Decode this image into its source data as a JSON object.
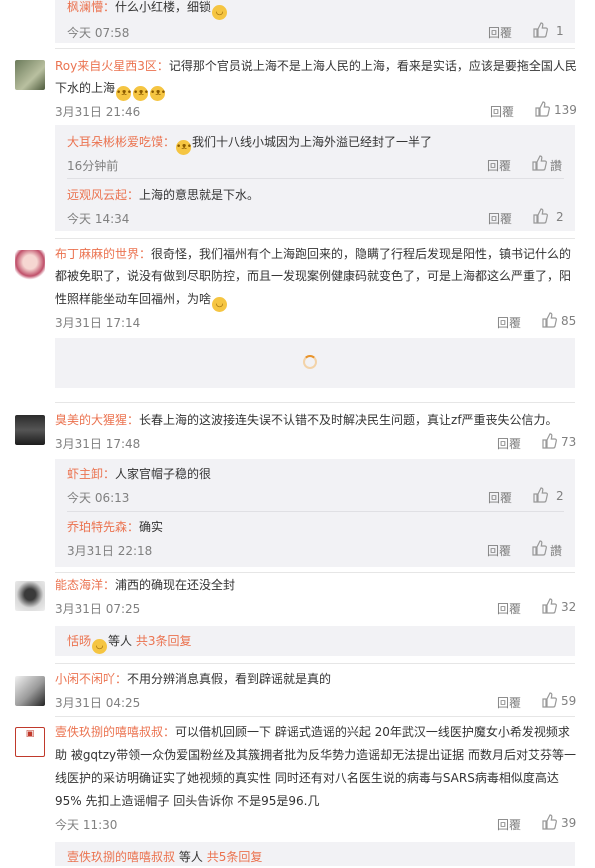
{
  "actions": {
    "reply": "回覆"
  },
  "comments": [
    {
      "user": "枫澜懵：",
      "text": "什么小红楼，细锁",
      "time": "今天 07:58",
      "likes": "1"
    },
    {
      "user": "Roy来自火星西3区：",
      "text1": "记得那个官员说上海不是上海人民的上海，看来是实话，应该是要拖全国人民",
      "text2": "下水的上海",
      "time": "3月31日 21:46",
      "likes": "139",
      "replies": [
        {
          "user": "大耳朵彬彬爱吃馍：",
          "text": "我们十八线小城因为上海外溢已经封了一半了",
          "time": "16分钟前",
          "likes": "讚"
        },
        {
          "user": "远观风云起：",
          "text": "上海的意思就是下水。",
          "time": "今天 14:34",
          "likes": "2"
        }
      ]
    },
    {
      "user": "布丁麻麻的世界：",
      "text1": "很奇怪，我们福州有个上海跑回来的，隐瞒了行程后发现是阳性，镇书记什么的",
      "text2": "都被免职了，说没有做到尽职防控，而且一发现案例健康码就变色了，可是上海都这么严重了，阳",
      "text3": "性照样能坐动车回福州，为啥",
      "time": "3月31日 17:14",
      "likes": "85"
    },
    {
      "user": "臭美的大猩猩：",
      "text": "长春上海的这波接连失误不认错不及时解决民生问题，真让zf严重丧失公信力。",
      "time": "3月31日 17:48",
      "likes": "73",
      "replies": [
        {
          "user": "虾主卸：",
          "text": "人家官帽子稳的很",
          "time": "今天 06:13",
          "likes": "2"
        },
        {
          "user": "乔珀特先森：",
          "text": "确实",
          "time": "3月31日 22:18",
          "likes": "讚"
        }
      ]
    },
    {
      "user": "能态海洋：",
      "text": "浦西的确现在还没全封",
      "time": "3月31日 07:25",
      "likes": "32",
      "more": {
        "user": "恬旸",
        "mid": "等人",
        "count": "共3条回复"
      }
    },
    {
      "user": "小闲不闲吖：",
      "text": "不用分辨消息真假，看到辟谣就是真的",
      "time": "3月31日 04:25",
      "likes": "59"
    },
    {
      "user": "壹佚玖捌的嘻嘻叔叔：",
      "text1": "可以借机回顾一下 辟谣式造谣的兴起 20年武汉一线医护魔女小希发视频求",
      "text2": "助 被gqtzy带领一众伪爱国粉丝及其簇拥者批为反华势力造谣却无法提出证据 而数月后对艾芬等一",
      "text3": "线医护的采访明确证实了她视频的真实性 同时还有对八名医生说的病毒与SARS病毒相似度高达",
      "text4": "95% 先扣上造谣帽子 回头告诉你 不是95是96.几",
      "time": "今天 11:30",
      "likes": "39",
      "more": {
        "user": "壹佚玖捌的嘻嘻叔叔",
        "mid": "等人",
        "count": "共5条回复"
      }
    }
  ]
}
